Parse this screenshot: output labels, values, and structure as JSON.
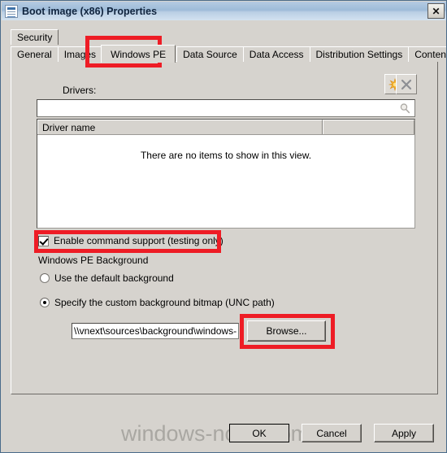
{
  "window": {
    "title": "Boot image (x86) Properties",
    "icon": "properties-document-icon",
    "close_label": "✕"
  },
  "tabs": {
    "row1": [
      {
        "label": "Security",
        "active": false
      }
    ],
    "row2": [
      {
        "label": "General",
        "active": false
      },
      {
        "label": "Images",
        "active": false
      },
      {
        "label": "Windows PE",
        "active": true
      },
      {
        "label": "Data Source",
        "active": false
      },
      {
        "label": "Data Access",
        "active": false
      },
      {
        "label": "Distribution Settings",
        "active": false
      },
      {
        "label": "Content Locations",
        "active": false
      }
    ]
  },
  "drivers": {
    "label": "Drivers:",
    "add_icon": "star-add-icon",
    "remove_icon": "x-remove-icon",
    "search": {
      "value": "",
      "placeholder": "",
      "icon": "search-magnifier-icon"
    },
    "columns": [
      "Driver name",
      ""
    ],
    "empty_message": "There are no items to show in this view.",
    "rows": []
  },
  "command_support": {
    "label": "Enable command support (testing only)",
    "checked": true
  },
  "background_group": {
    "legend": "Windows PE Background",
    "options": [
      {
        "label": "Use the default background",
        "selected": false
      },
      {
        "label": "Specify the custom background bitmap (UNC path)",
        "selected": true
      }
    ],
    "path": {
      "value": "\\\\vnext\\sources\\background\\windows-",
      "placeholder": ""
    },
    "browse_label": "Browse..."
  },
  "footer": {
    "ok_label": "OK",
    "cancel_label": "Cancel",
    "apply_label": "Apply"
  },
  "watermark": {
    "text": "windows-noob.com"
  },
  "colors": {
    "dialog_face": "#d6d3ce",
    "titlebar_blue": "#9dbbd8",
    "annotation_red": "#ee1c25",
    "add_icon_orange": "#f5a623",
    "watermark_gray": "#a9a7a2"
  }
}
